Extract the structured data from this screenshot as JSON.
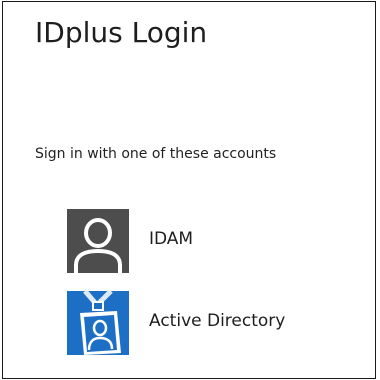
{
  "window": {
    "title": "IDplus Login"
  },
  "prompt": {
    "text": "Sign in with one of these accounts"
  },
  "accounts": [
    {
      "label": "IDAM",
      "icon": "user-silhouette-icon",
      "tile_color": "#4d4d4d"
    },
    {
      "label": "Active Directory",
      "icon": "id-badge-icon",
      "tile_color": "#1c6fc4"
    }
  ]
}
